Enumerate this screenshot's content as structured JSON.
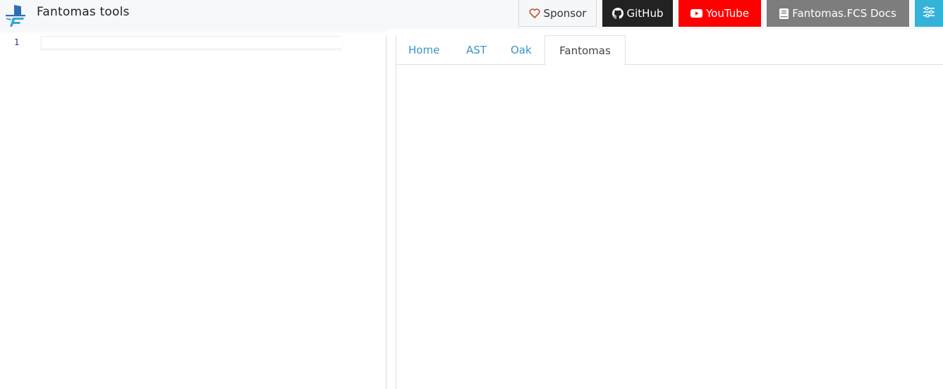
{
  "header": {
    "title": "Fantomas tools",
    "logo_icon": "fantomas-logo",
    "buttons": [
      {
        "label": "Sponsor",
        "icon": "heart-icon",
        "color": "#f6f7f8"
      },
      {
        "label": "GitHub",
        "icon": "github-icon",
        "color": "#222222"
      },
      {
        "label": "YouTube",
        "icon": "youtube-icon",
        "color": "#ff0000"
      },
      {
        "label": "Fantomas.FCS Docs",
        "icon": "book-icon",
        "color": "#7d7d7d"
      },
      {
        "label": "",
        "icon": "sliders-icon",
        "color": "#34b3d9"
      }
    ]
  },
  "editor": {
    "line_numbers": [
      "1"
    ],
    "content": ""
  },
  "tabs": [
    {
      "label": "Home",
      "active": false
    },
    {
      "label": "AST",
      "active": false
    },
    {
      "label": "Oak",
      "active": false
    },
    {
      "label": "Fantomas",
      "active": true
    }
  ],
  "colors": {
    "link": "#3a94c3",
    "accent": "#34b3d9"
  }
}
